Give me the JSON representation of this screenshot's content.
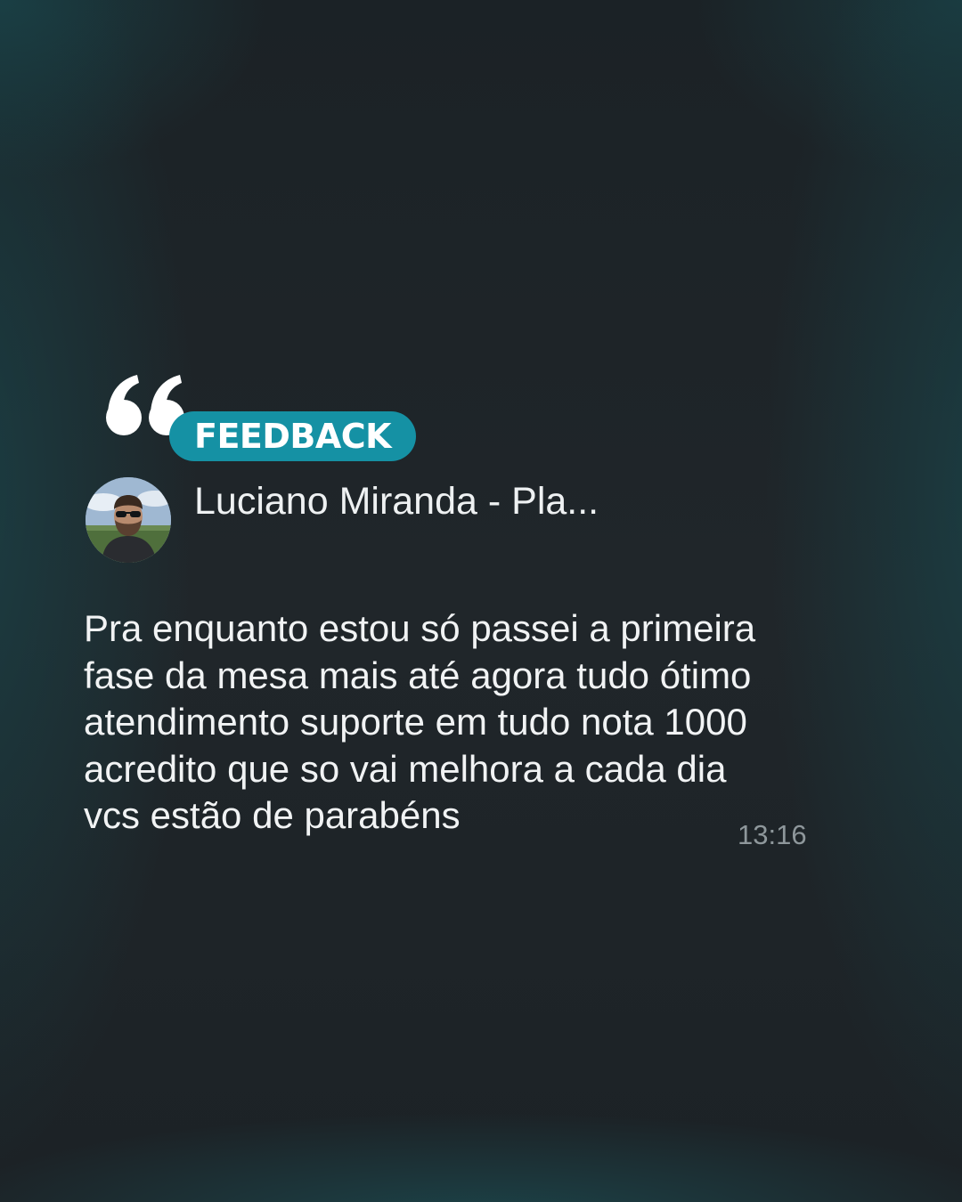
{
  "badge": {
    "label": "FEEDBACK",
    "color": "#1591a4"
  },
  "icons": {
    "quote": "open-quote-icon",
    "avatar": "profile-photo"
  },
  "contact": {
    "name": "Luciano Miranda - Pla..."
  },
  "message": {
    "lines": [
      "Pra enquanto estou só passei a primeira",
      "fase da mesa mais até agora tudo ótimo",
      "atendimento suporte em tudo nota 1000",
      "acredito que so vai melhora a cada dia",
      "vcs estão de parabéns"
    ],
    "time": "13:16"
  },
  "colors": {
    "background": "#1e2428",
    "accent": "#1591a4",
    "text": "#f1f3f4",
    "timestamp": "#8e979b"
  }
}
